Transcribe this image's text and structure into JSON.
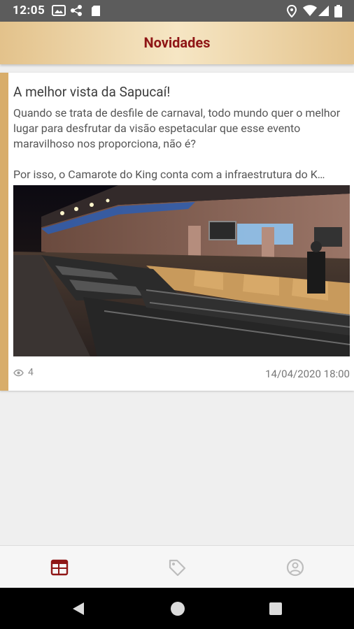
{
  "status_bar": {
    "time": "12:05"
  },
  "app_bar": {
    "title": "Novidades"
  },
  "post": {
    "title": "A melhor vista da Sapucaí!",
    "paragraph_1": "Quando se trata de desfile de carnaval, todo mundo quer o melhor lugar para desfrutar da visão espetacular que esse evento maravilhoso nos proporciona, não é?",
    "paragraph_2": "Por isso, o Camarote do King conta com a infraestrutura do K…",
    "views": "4",
    "date": "14/04/2020 18:00"
  },
  "colors": {
    "accent": "#d8ad6a",
    "title": "#8f1616",
    "active_tab": "#8f1616",
    "inactive_tab": "#bdbdbd"
  },
  "bottom_nav": {
    "items": [
      "calendar-icon",
      "tag-icon",
      "user-circle-icon"
    ],
    "active": 0
  }
}
